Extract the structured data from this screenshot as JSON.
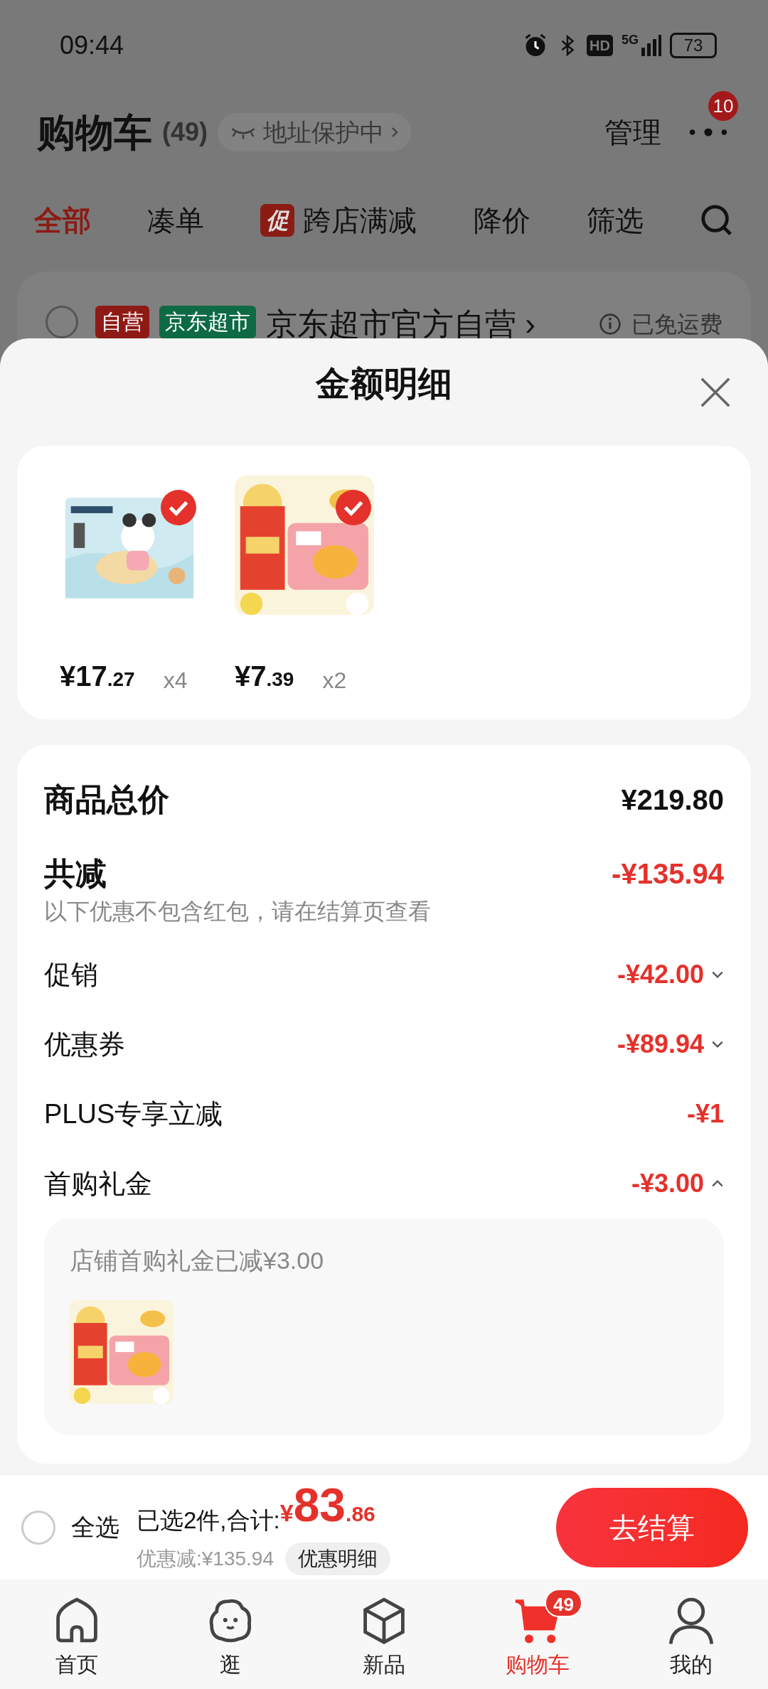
{
  "status_bar": {
    "time": "09:44",
    "hd": "HD",
    "network": "5G",
    "battery": "73"
  },
  "background": {
    "header": {
      "title": "购物车",
      "count": "(49)",
      "address_chip": "地址保护中",
      "manage": "管理",
      "more_badge": "10"
    },
    "tabs": [
      {
        "label": "全部",
        "selected": true
      },
      {
        "label": "凑单",
        "selected": false
      },
      {
        "label": "跨店满减",
        "selected": false,
        "tag": "促"
      },
      {
        "label": "降价",
        "selected": false
      },
      {
        "label": "筛选",
        "selected": false
      }
    ],
    "store": {
      "checked": false,
      "tags": [
        {
          "label": "自营",
          "color": "#8e1a15"
        },
        {
          "label": "京东超市",
          "color": "#0d6a45"
        }
      ],
      "name": "京东超市官方自营 ›",
      "shipping": "已免运费"
    }
  },
  "sheet": {
    "title": "金额明细",
    "products": [
      {
        "price": "¥17.27",
        "qty": "x4",
        "selected": true,
        "kind": "picture"
      },
      {
        "price": "¥7.39",
        "qty": "x2",
        "selected": true,
        "kind": "picture"
      }
    ],
    "summary": {
      "total_label": "商品总价",
      "total_value": "¥219.80",
      "discount_label": "共减",
      "discount_value": "-¥135.94",
      "note": "以下优惠不包含红包，请在结算页查看",
      "items": [
        {
          "label": "促销",
          "value": "-¥42.00",
          "expanded": false
        },
        {
          "label": "优惠券",
          "value": "-¥89.94",
          "expanded": false
        },
        {
          "label": "PLUS专享立减",
          "value": "-¥1"
        },
        {
          "label": "首购礼金",
          "value": "-¥3.00",
          "expanded": true,
          "detail": {
            "text": "店铺首购礼金已减¥3.00",
            "kind": "picture"
          }
        }
      ]
    }
  },
  "bottom_bar": {
    "select_all": {
      "label": "全选",
      "checked": false
    },
    "selected_text": "已选2件,合计:",
    "total": "¥83.86",
    "saving": "优惠减:¥135.94",
    "details_button": "优惠明细",
    "checkout": "去结算"
  },
  "nav": [
    {
      "label": "首页",
      "kind": "home",
      "selected": false
    },
    {
      "label": "逛",
      "kind": "blob",
      "selected": false
    },
    {
      "label": "新品",
      "kind": "cube",
      "selected": false
    },
    {
      "label": "购物车",
      "kind": "cart",
      "selected": true,
      "badge": "49"
    },
    {
      "label": "我的",
      "kind": "person",
      "selected": false
    }
  ]
}
